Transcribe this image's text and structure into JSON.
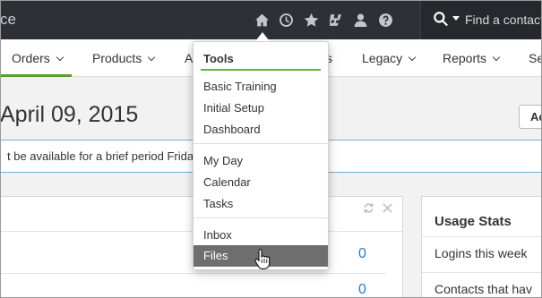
{
  "topbar": {
    "brand_partial": "ce",
    "icons": [
      "home-icon",
      "history-icon",
      "star-icon",
      "puzzle-icon",
      "user-icon",
      "help-icon"
    ],
    "search": {
      "placeholder": "Find a contact"
    }
  },
  "nav": {
    "items": [
      {
        "label": "Orders",
        "active": true
      },
      {
        "label": "Products"
      },
      {
        "label": "A"
      },
      {
        "label": "s"
      },
      {
        "label": "Legacy"
      },
      {
        "label": "Reports"
      },
      {
        "label": "Se"
      }
    ]
  },
  "page": {
    "title": "April 09, 2015",
    "action_label": "Ac",
    "notice": "t be available for a brief period Friday a"
  },
  "panel_left": {
    "counts": [
      "0",
      "0"
    ]
  },
  "usage_stats": {
    "title": "Usage Stats",
    "rows": [
      "Logins this week",
      "Contacts that hav"
    ]
  },
  "tools_menu": {
    "header": "Tools",
    "groups": [
      [
        "Basic Training",
        "Initial Setup",
        "Dashboard"
      ],
      [
        "My Day",
        "Calendar",
        "Tasks"
      ],
      [
        "Inbox",
        "Files"
      ]
    ],
    "hovered": "Files"
  },
  "colors": {
    "topbar": "#2d3136",
    "accent_green": "#6cb33f",
    "link_blue": "#2a7bc1",
    "hover_gray": "#6e6e6e",
    "notice_border": "#6fb1d8"
  }
}
